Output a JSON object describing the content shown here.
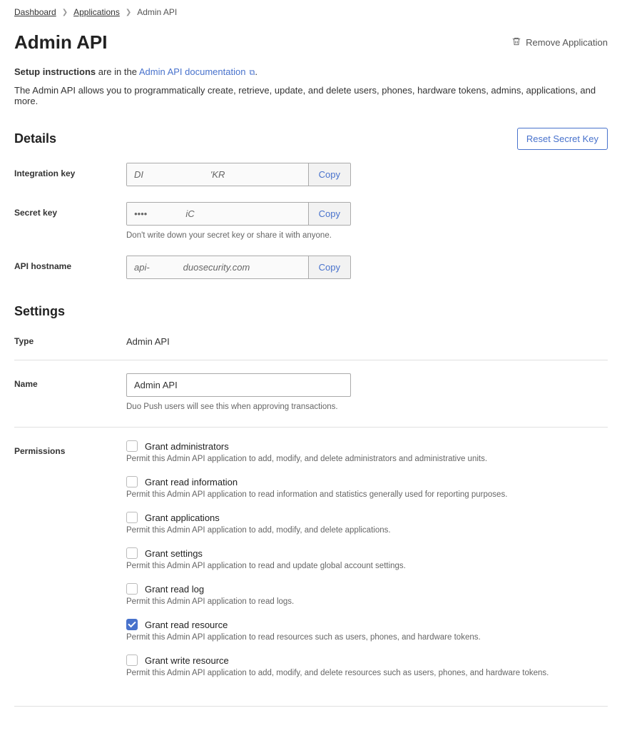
{
  "breadcrumb": {
    "dashboard": "Dashboard",
    "applications": "Applications",
    "current": "Admin API"
  },
  "header": {
    "title": "Admin API",
    "remove_label": "Remove Application"
  },
  "intro": {
    "setup_bold": "Setup instructions",
    "setup_rest": " are in the ",
    "doc_link": "Admin API documentation",
    "period": ".",
    "description": "The Admin API allows you to programmatically create, retrieve, update, and delete users, phones, hardware tokens, admins, applications, and more."
  },
  "details": {
    "heading": "Details",
    "reset_label": "Reset Secret Key",
    "integration_key": {
      "label": "Integration key",
      "value": "DI                          'KR",
      "copy": "Copy"
    },
    "secret_key": {
      "label": "Secret key",
      "value": "••••               iC",
      "copy": "Copy",
      "hint": "Don't write down your secret key or share it with anyone."
    },
    "api_hostname": {
      "label": "API hostname",
      "value": "api-             duosecurity.com",
      "copy": "Copy"
    }
  },
  "settings": {
    "heading": "Settings",
    "type": {
      "label": "Type",
      "value": "Admin API"
    },
    "name": {
      "label": "Name",
      "value": "Admin API",
      "hint": "Duo Push users will see this when approving transactions."
    },
    "permissions": {
      "label": "Permissions",
      "items": [
        {
          "title": "Grant administrators",
          "desc": "Permit this Admin API application to add, modify, and delete administrators and administrative units.",
          "checked": false
        },
        {
          "title": "Grant read information",
          "desc": "Permit this Admin API application to read information and statistics generally used for reporting purposes.",
          "checked": false
        },
        {
          "title": "Grant applications",
          "desc": "Permit this Admin API application to add, modify, and delete applications.",
          "checked": false
        },
        {
          "title": "Grant settings",
          "desc": "Permit this Admin API application to read and update global account settings.",
          "checked": false
        },
        {
          "title": "Grant read log",
          "desc": "Permit this Admin API application to read logs.",
          "checked": false
        },
        {
          "title": "Grant read resource",
          "desc": "Permit this Admin API application to read resources such as users, phones, and hardware tokens.",
          "checked": true
        },
        {
          "title": "Grant write resource",
          "desc": "Permit this Admin API application to add, modify, and delete resources such as users, phones, and hardware tokens.",
          "checked": false
        }
      ]
    }
  }
}
